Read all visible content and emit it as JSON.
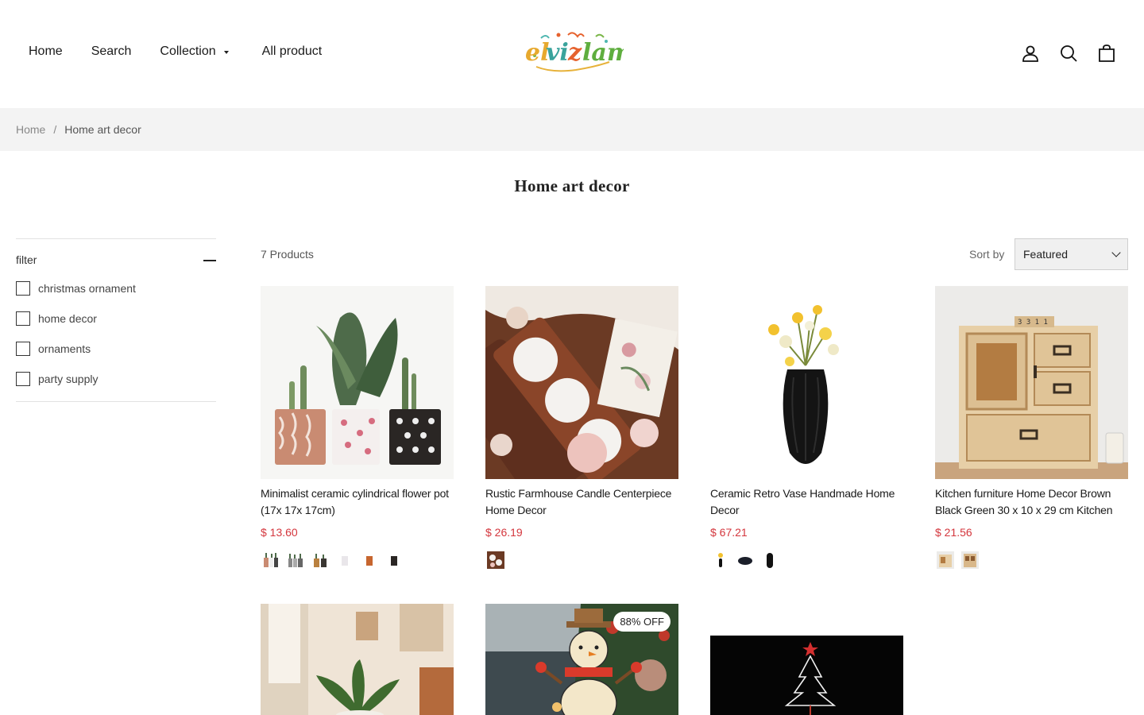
{
  "nav": {
    "items": [
      {
        "label": "Home"
      },
      {
        "label": "Search"
      },
      {
        "label": "Collection"
      },
      {
        "label": "All product"
      }
    ],
    "logo_text": "elvizlam"
  },
  "icons": [
    "account-icon",
    "search-icon",
    "cart-icon"
  ],
  "breadcrumb": {
    "home": "Home",
    "separator": "/",
    "current": "Home art decor"
  },
  "page_title": "Home art decor",
  "filter": {
    "heading": "filter",
    "options": [
      "christmas ornament",
      "home decor",
      "ornaments",
      "party supply"
    ]
  },
  "toolbar": {
    "count": "7 Products",
    "sort_label": "Sort by",
    "sort_value": "Featured"
  },
  "products": [
    {
      "title": "Minimalist ceramic cylindrical flower pot (17x 17x 17cm)",
      "price": "$ 13.60",
      "swatch_count": 6
    },
    {
      "title": "Rustic Farmhouse Candle Centerpiece Home Decor",
      "price": "$ 26.19",
      "swatch_count": 1
    },
    {
      "title": "Ceramic Retro Vase Handmade Home Decor",
      "price": "$ 67.21",
      "swatch_count": 3
    },
    {
      "title": "Kitchen furniture Home Decor Brown Black Green 30 x 10 x 29 cm Kitchen",
      "price": "$ 21.56",
      "swatch_count": 2
    },
    {
      "title": "",
      "price": ""
    },
    {
      "title": "",
      "price": "",
      "badge": "88% OFF"
    },
    {
      "title": "",
      "price": ""
    }
  ],
  "colors": {
    "price": "#d4363d",
    "breadcrumb_bg": "#f3f3f3"
  }
}
